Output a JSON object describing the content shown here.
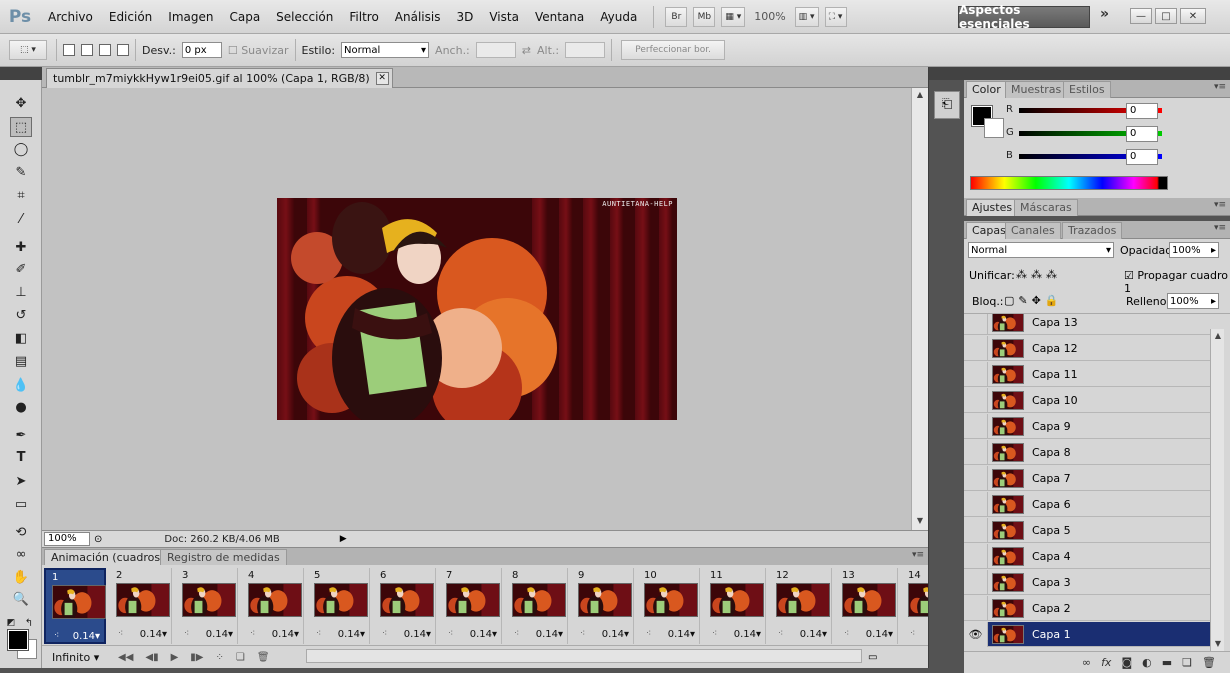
{
  "app": {
    "logo": "Ps"
  },
  "menu": [
    "Archivo",
    "Edición",
    "Imagen",
    "Capa",
    "Selección",
    "Filtro",
    "Análisis",
    "3D",
    "Vista",
    "Ventana",
    "Ayuda"
  ],
  "appbar": {
    "bridge": "Br",
    "minibridge": "Mb",
    "zoom": "100%",
    "workspace": "Aspectos esenciales",
    "more": "»"
  },
  "options": {
    "desv_label": "Desv.:",
    "desv_value": "0 px",
    "suavizar_label": "Suavizar",
    "estilo_label": "Estilo:",
    "estilo_value": "Normal",
    "anch_label": "Anch.:",
    "alt_label": "Alt.:",
    "refine_button": "Perfeccionar bor."
  },
  "document": {
    "tab_title": "tumblr_m7miykkHyw1r9ei05.gif al 100% (Capa 1, RGB/8)",
    "watermark": "AUNTIETANA-HELP",
    "status_zoom": "100%",
    "status_doc": "Doc: 260.2 KB/4.06 MB"
  },
  "animation": {
    "tabs": [
      "Animación (cuadros)",
      "Registro de medidas"
    ],
    "frames": [
      {
        "num": "1",
        "delay": "0.14"
      },
      {
        "num": "2",
        "delay": "0.14"
      },
      {
        "num": "3",
        "delay": "0.14"
      },
      {
        "num": "4",
        "delay": "0.14"
      },
      {
        "num": "5",
        "delay": "0.14"
      },
      {
        "num": "6",
        "delay": "0.14"
      },
      {
        "num": "7",
        "delay": "0.14"
      },
      {
        "num": "8",
        "delay": "0.14"
      },
      {
        "num": "9",
        "delay": "0.14"
      },
      {
        "num": "10",
        "delay": "0.14"
      },
      {
        "num": "11",
        "delay": "0.14"
      },
      {
        "num": "12",
        "delay": "0.14"
      },
      {
        "num": "13",
        "delay": "0.14"
      },
      {
        "num": "14",
        "delay": "0.14"
      }
    ],
    "selected_frame": 1,
    "loop": "Infinito"
  },
  "color_panel": {
    "tabs": [
      "Color",
      "Muestras",
      "Estilos"
    ],
    "r_label": "R",
    "g_label": "G",
    "b_label": "B",
    "r": "0",
    "g": "0",
    "b": "0"
  },
  "adjust_panel": {
    "tabs": [
      "Ajustes",
      "Máscaras"
    ]
  },
  "layers_panel": {
    "tabs": [
      "Capas",
      "Canales",
      "Trazados"
    ],
    "blend_mode": "Normal",
    "opacity_label": "Opacidad:",
    "opacity": "100%",
    "unify_label": "Unificar:",
    "propagate_label": "Propagar cuadro 1",
    "lock_label": "Bloq.:",
    "fill_label": "Relleno:",
    "fill": "100%",
    "layers": [
      "Capa 13",
      "Capa 12",
      "Capa 11",
      "Capa 10",
      "Capa 9",
      "Capa 8",
      "Capa 7",
      "Capa 6",
      "Capa 5",
      "Capa 4",
      "Capa 3",
      "Capa 2",
      "Capa 1"
    ],
    "selected_layer": "Capa 1",
    "bottom_icons": [
      "link-icon",
      "fx-icon",
      "mask-icon",
      "adjustment-icon",
      "folder-icon",
      "new-layer-icon",
      "trash-icon"
    ]
  },
  "colors": {
    "accent_selected": "#1a2e72",
    "frame_selected": "#2b4b8c",
    "canvas_bg": "#c2c2c2"
  }
}
